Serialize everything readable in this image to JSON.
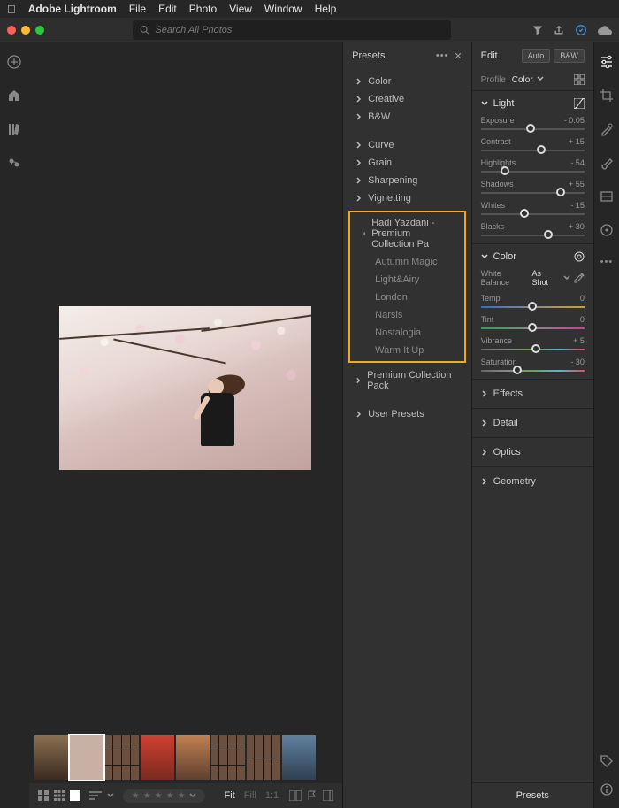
{
  "menubar": {
    "app": "Adobe Lightroom",
    "items": [
      "File",
      "Edit",
      "Photo",
      "View",
      "Window",
      "Help"
    ]
  },
  "search": {
    "placeholder": "Search All Photos"
  },
  "presets_panel": {
    "title": "Presets",
    "groups1": [
      "Color",
      "Creative",
      "B&W"
    ],
    "groups2": [
      "Curve",
      "Grain",
      "Sharpening",
      "Vignetting"
    ],
    "highlighted_group": "Hadi Yazdani - Premium Collection Pa",
    "highlighted_items": [
      "Autumn Magic",
      "Light&Airy",
      "London",
      "Narsis",
      "Nostalogia",
      "Warm It Up"
    ],
    "groups3": [
      "Premium Collection Pack"
    ],
    "groups4": [
      "User Presets"
    ]
  },
  "edit_panel": {
    "title": "Edit",
    "auto": "Auto",
    "bw": "B&W",
    "profile_label": "Profile",
    "profile_value": "Color",
    "light": {
      "title": "Light",
      "sliders": [
        {
          "label": "Exposure",
          "value": "- 0.05",
          "pos": 48
        },
        {
          "label": "Contrast",
          "value": "+ 15",
          "pos": 58
        },
        {
          "label": "Highlights",
          "value": "- 54",
          "pos": 23
        },
        {
          "label": "Shadows",
          "value": "+ 55",
          "pos": 77
        },
        {
          "label": "Whites",
          "value": "- 15",
          "pos": 42
        },
        {
          "label": "Blacks",
          "value": "+ 30",
          "pos": 65
        }
      ]
    },
    "color": {
      "title": "Color",
      "wb_label": "White Balance",
      "wb_value": "As Shot",
      "sliders": [
        {
          "label": "Temp",
          "value": "0",
          "pos": 50,
          "grad": "temp"
        },
        {
          "label": "Tint",
          "value": "0",
          "pos": 50,
          "grad": "tint"
        },
        {
          "label": "Vibrance",
          "value": "+ 5",
          "pos": 53,
          "grad": "vib"
        },
        {
          "label": "Saturation",
          "value": "- 30",
          "pos": 35,
          "grad": "sat"
        }
      ]
    },
    "collapsed": [
      "Effects",
      "Detail",
      "Optics",
      "Geometry"
    ],
    "footer": "Presets"
  },
  "bottombar": {
    "fit": "Fit",
    "fill": "Fill",
    "oneone": "1:1"
  }
}
